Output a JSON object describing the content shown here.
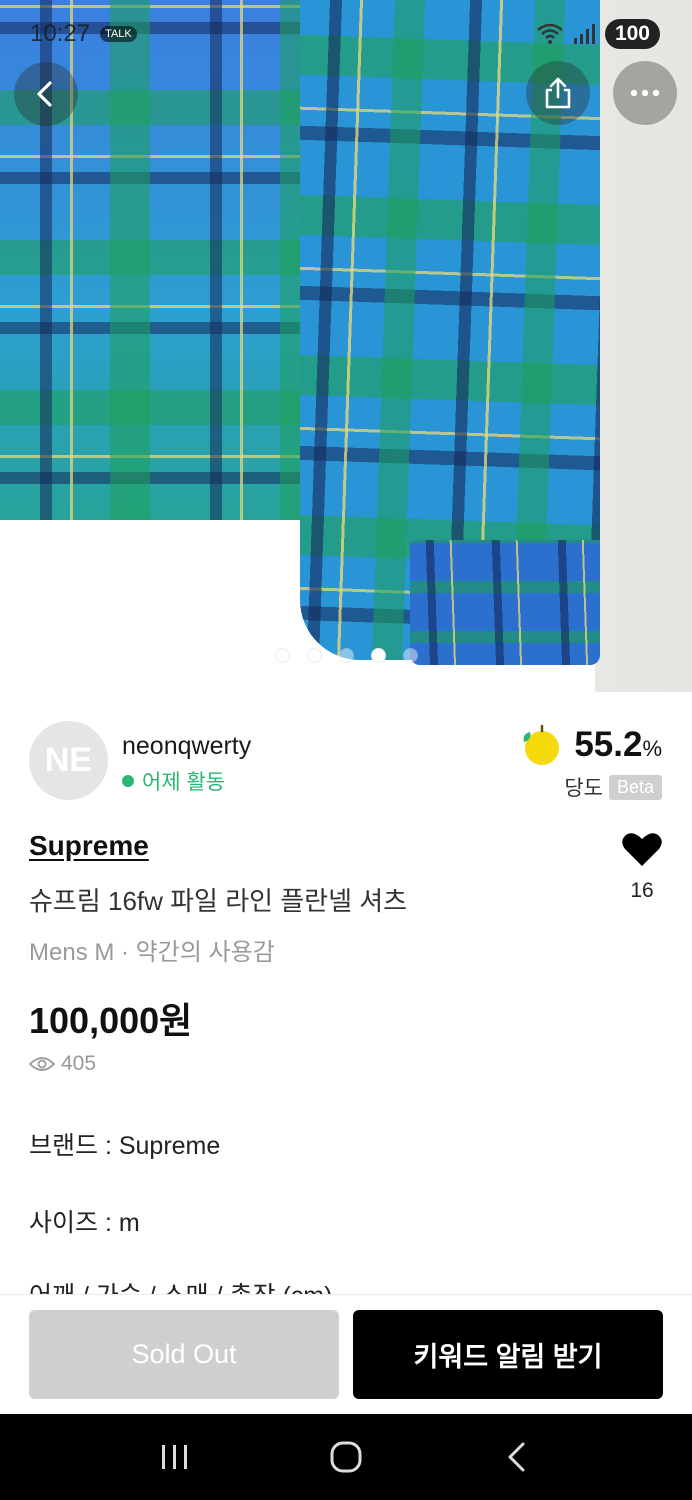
{
  "status_bar": {
    "time": "10:27",
    "talk_badge": "TALK",
    "battery": "100"
  },
  "gallery": {
    "dot_count": 5,
    "active_index": 3
  },
  "seller": {
    "initials": "NE",
    "name": "neonqwerty",
    "activity": "어제 활동",
    "rating_value": "55.2",
    "rating_unit": "%",
    "rating_label": "당도",
    "beta_label": "Beta"
  },
  "product": {
    "brand": "Supreme",
    "title": "슈프림 16fw 파일 라인 플란넬 셔츠",
    "meta": "Mens M · 약간의 사용감",
    "likes": "16",
    "price": "100,000원",
    "views": "405"
  },
  "description": {
    "line1": "브랜드 : Supreme",
    "line2": "사이즈 : m",
    "line3": "어깨 / 가슴 / 소매 / 총장 (cm)"
  },
  "actions": {
    "sold_out": "Sold Out",
    "keyword_alert": "키워드 알림 받기"
  },
  "colors": {
    "accent_green": "#2bb673",
    "apple_yellow": "#f5d90a",
    "disabled_gray": "#cfcfcf",
    "primary_black": "#000000"
  },
  "icons": {
    "back": "chevron-left-icon",
    "share": "share-icon",
    "more": "more-horizontal-icon",
    "like": "heart-icon",
    "views": "eye-icon",
    "rating": "apple-icon"
  }
}
